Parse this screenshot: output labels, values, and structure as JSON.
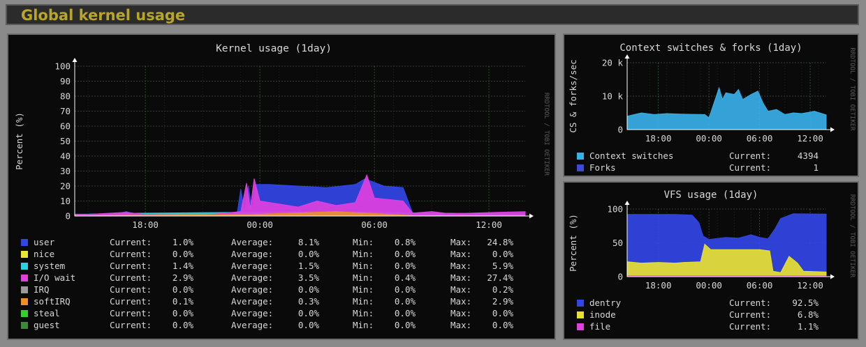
{
  "header": {
    "title": "Global kernel usage"
  },
  "watermark": "RRDTOOL / TOBI OETIKER",
  "colors": {
    "background": "#0a0a0a",
    "grid": "#3c5a3c",
    "text": "#d8d8d8",
    "header_text": "#b8a52a"
  },
  "chart_data": [
    {
      "type": "area",
      "title": "Kernel usage  (1day)",
      "xlabel": "",
      "ylabel": "Percent (%)",
      "ylim": [
        0,
        100
      ],
      "yticks": [
        "0",
        "10",
        "20",
        "30",
        "40",
        "50",
        "60",
        "70",
        "80",
        "90",
        "100"
      ],
      "x_range_hours": [
        14.3,
        13.9
      ],
      "xticks": [
        "18:00",
        "00:00",
        "06:00",
        "12:00"
      ],
      "grid": true,
      "legend_position": "bottom",
      "legend_columns": [
        "Current:",
        "Average:",
        "Min:",
        "Max:"
      ],
      "series": [
        {
          "name": "user",
          "color": "#3246e6",
          "current": "1.0%",
          "average": "8.1%",
          "min": "0.8%",
          "max": "24.8%",
          "points": [
            [
              14.3,
              1.2
            ],
            [
              16.5,
              1.4
            ],
            [
              17.0,
              3.0
            ],
            [
              17.5,
              1.2
            ],
            [
              21.0,
              1.0
            ],
            [
              22.8,
              1.0
            ],
            [
              23.0,
              18
            ],
            [
              23.2,
              2
            ],
            [
              23.4,
              20
            ],
            [
              23.6,
              3
            ],
            [
              23.8,
              21
            ],
            [
              24.5,
              21
            ],
            [
              26.0,
              20
            ],
            [
              27.5,
              19
            ],
            [
              29.0,
              21
            ],
            [
              29.5,
              24.8
            ],
            [
              30.5,
              20
            ],
            [
              31.5,
              19
            ],
            [
              32.0,
              2
            ],
            [
              33.0,
              1.5
            ],
            [
              35.0,
              1.2
            ],
            [
              37.9,
              1.0
            ]
          ]
        },
        {
          "name": "nice",
          "color": "#e8e830",
          "current": "0.0%",
          "average": "0.0%",
          "min": "0.0%",
          "max": "0.0%",
          "points": []
        },
        {
          "name": "system",
          "color": "#30d0e0",
          "current": "1.4%",
          "average": "1.5%",
          "min": "0.0%",
          "max": "5.9%",
          "points": [
            [
              14.3,
              1.0
            ],
            [
              17.0,
              1.8
            ],
            [
              23.5,
              2.5
            ],
            [
              28.0,
              3.0
            ],
            [
              32.0,
              2.0
            ],
            [
              37.9,
              1.4
            ]
          ]
        },
        {
          "name": "I/O wait",
          "color": "#e040e0",
          "current": "2.9%",
          "average": "3.5%",
          "min": "0.4%",
          "max": "27.4%",
          "points": [
            [
              14.3,
              0.6
            ],
            [
              17.0,
              2.5
            ],
            [
              18.0,
              1.0
            ],
            [
              21.0,
              0.5
            ],
            [
              23.0,
              3
            ],
            [
              23.3,
              22
            ],
            [
              23.5,
              5
            ],
            [
              23.7,
              25
            ],
            [
              24.0,
              10
            ],
            [
              25.0,
              8
            ],
            [
              26.0,
              6
            ],
            [
              27.0,
              10
            ],
            [
              28.0,
              7
            ],
            [
              29.0,
              9
            ],
            [
              29.6,
              27.4
            ],
            [
              30.0,
              12
            ],
            [
              31.5,
              10
            ],
            [
              32.0,
              2
            ],
            [
              33.0,
              3
            ],
            [
              34.0,
              1.5
            ],
            [
              36.5,
              2.5
            ],
            [
              37.9,
              2.9
            ]
          ]
        },
        {
          "name": "IRQ",
          "color": "#9a9a9a",
          "current": "0.0%",
          "average": "0.0%",
          "min": "0.0%",
          "max": "0.2%",
          "points": []
        },
        {
          "name": "softIRQ",
          "color": "#e8902a",
          "current": "0.1%",
          "average": "0.3%",
          "min": "0.0%",
          "max": "2.9%",
          "points": [
            [
              14.3,
              0.2
            ],
            [
              23.5,
              1.0
            ],
            [
              28.0,
              2.9
            ],
            [
              32.0,
              0.3
            ],
            [
              37.9,
              0.1
            ]
          ]
        },
        {
          "name": "steal",
          "color": "#30d030",
          "current": "0.0%",
          "average": "0.0%",
          "min": "0.0%",
          "max": "0.0%",
          "points": []
        },
        {
          "name": "guest",
          "color": "#3a8a3a",
          "current": "0.0%",
          "average": "0.0%",
          "min": "0.0%",
          "max": "0.0%",
          "points": []
        }
      ]
    },
    {
      "type": "area",
      "title": "Context switches & forks  (1day)",
      "xlabel": "",
      "ylabel": "CS & forks/sec",
      "ylim": [
        0,
        20000
      ],
      "yticks": [
        "0",
        "10 k",
        "20 k"
      ],
      "x_range_hours": [
        14.3,
        13.9
      ],
      "xticks": [
        "18:00",
        "00:00",
        "06:00",
        "12:00"
      ],
      "grid": true,
      "legend_position": "bottom",
      "series": [
        {
          "name": "Context switches",
          "color": "#38b0e8",
          "current_label": "Current:",
          "current": "4394",
          "points": [
            [
              14.3,
              4000
            ],
            [
              16.0,
              5000
            ],
            [
              17.5,
              4500
            ],
            [
              19.0,
              4800
            ],
            [
              21.0,
              4600
            ],
            [
              23.5,
              4500
            ],
            [
              24.0,
              3500
            ],
            [
              24.6,
              8000
            ],
            [
              25.2,
              12500
            ],
            [
              25.6,
              9000
            ],
            [
              26.0,
              11000
            ],
            [
              27.0,
              10500
            ],
            [
              27.5,
              12000
            ],
            [
              28.0,
              9000
            ],
            [
              29.0,
              10500
            ],
            [
              29.8,
              11500
            ],
            [
              30.4,
              8000
            ],
            [
              31.0,
              5500
            ],
            [
              32.0,
              6000
            ],
            [
              33.0,
              4500
            ],
            [
              34.0,
              5000
            ],
            [
              35.0,
              4800
            ],
            [
              36.5,
              5500
            ],
            [
              37.9,
              4394
            ]
          ]
        },
        {
          "name": "Forks",
          "color": "#3e4ad0",
          "current_label": "Current:",
          "current": "1",
          "points": []
        }
      ]
    },
    {
      "type": "area",
      "title": "VFS usage  (1day)",
      "xlabel": "",
      "ylabel": "Percent (%)",
      "ylim": [
        0,
        100
      ],
      "yticks": [
        "0",
        "50",
        "100"
      ],
      "x_range_hours": [
        14.3,
        13.9
      ],
      "xticks": [
        "18:00",
        "00:00",
        "06:00",
        "12:00"
      ],
      "grid": true,
      "legend_position": "bottom",
      "series": [
        {
          "name": "dentry",
          "color": "#3246e6",
          "current_label": "Current:",
          "current": "92.5%",
          "points": [
            [
              14.3,
              92
            ],
            [
              17.0,
              92
            ],
            [
              20.0,
              92
            ],
            [
              22.0,
              91
            ],
            [
              22.8,
              80
            ],
            [
              23.3,
              60
            ],
            [
              24.0,
              55
            ],
            [
              26.0,
              58
            ],
            [
              27.5,
              57
            ],
            [
              29.0,
              62
            ],
            [
              30.0,
              58
            ],
            [
              31.0,
              56
            ],
            [
              31.8,
              70
            ],
            [
              32.5,
              86
            ],
            [
              34.0,
              93
            ],
            [
              37.9,
              92.5
            ]
          ]
        },
        {
          "name": "inode",
          "color": "#e8e030",
          "current_label": "Current:",
          "current": "6.8%",
          "points": [
            [
              14.3,
              22
            ],
            [
              16.0,
              20
            ],
            [
              18.0,
              21
            ],
            [
              20.0,
              20
            ],
            [
              21.0,
              21
            ],
            [
              23.0,
              22
            ],
            [
              23.5,
              48
            ],
            [
              24.2,
              40
            ],
            [
              26.0,
              40
            ],
            [
              28.0,
              40
            ],
            [
              30.0,
              40
            ],
            [
              31.2,
              38
            ],
            [
              31.6,
              8
            ],
            [
              32.5,
              6
            ],
            [
              33.5,
              30
            ],
            [
              34.5,
              20
            ],
            [
              35.2,
              8
            ],
            [
              37.9,
              6.8
            ]
          ]
        },
        {
          "name": "file",
          "color": "#e040e0",
          "current_label": "Current:",
          "current": "1.1%",
          "points": [
            [
              14.3,
              1.1
            ],
            [
              37.9,
              1.1
            ]
          ]
        }
      ]
    }
  ]
}
